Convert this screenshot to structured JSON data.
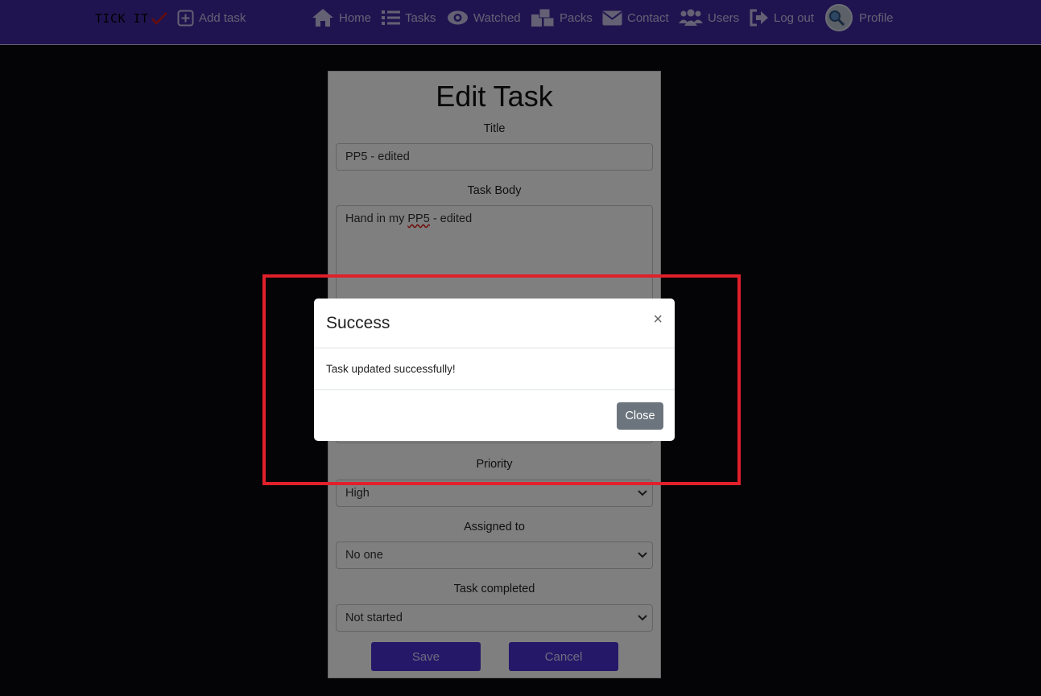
{
  "nav": {
    "brand": "TICK IT",
    "add_task": "Add task",
    "home": "Home",
    "tasks": "Tasks",
    "watched": "Watched",
    "packs": "Packs",
    "contact": "Contact",
    "users": "Users",
    "logout": "Log out",
    "profile": "Profile"
  },
  "form": {
    "heading": "Edit Task",
    "title_label": "Title",
    "title_value": "PP5 - edited",
    "body_label": "Task Body",
    "body_value_before": "Hand in my ",
    "body_value_misspelled": "PP5",
    "body_value_after": " - edited",
    "priority_label": "Priority",
    "priority_value": "High",
    "assigned_label": "Assigned to",
    "assigned_value": "No one",
    "completed_label": "Task completed",
    "completed_value": "Not started",
    "save": "Save",
    "cancel": "Cancel"
  },
  "modal": {
    "title": "Success",
    "close_symbol": "×",
    "message": "Task updated successfully!",
    "close_button": "Close"
  },
  "colors": {
    "navbar": "#4129a0",
    "button": "#4a30d0",
    "highlight": "#e0202a",
    "modal_close": "#6c757d"
  }
}
